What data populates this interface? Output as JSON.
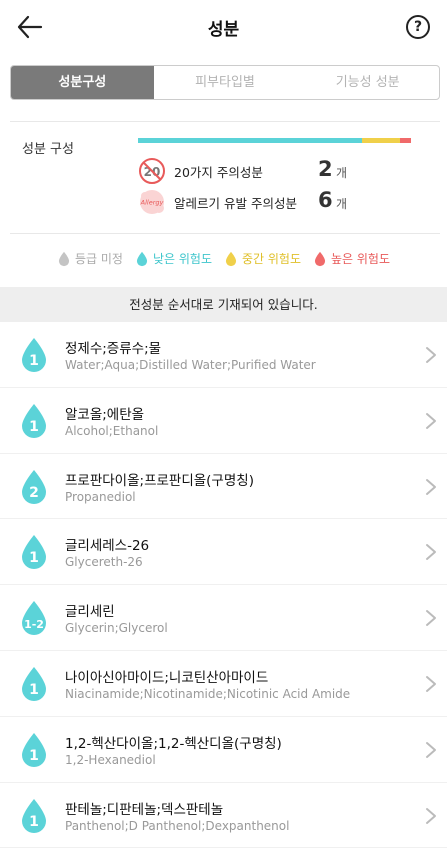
{
  "header": {
    "title": "성분",
    "help_label": "?"
  },
  "tabs": [
    {
      "label": "성분구성",
      "active": true
    },
    {
      "label": "피부타입별",
      "active": false
    },
    {
      "label": "기능성 성분",
      "active": false
    }
  ],
  "composition": {
    "label": "성분 구성",
    "bar_segments": [
      {
        "level": "low",
        "fraction": 0.82,
        "color": "#5bd3d8"
      },
      {
        "level": "medium",
        "fraction": 0.14,
        "color": "#f0d04a"
      },
      {
        "level": "high",
        "fraction": 0.04,
        "color": "#f06a6a"
      }
    ],
    "caution20": {
      "icon_text": "20",
      "label": "20가지 주의성분",
      "count": "2",
      "unit": "개"
    },
    "allergy": {
      "icon_text": "Allergy",
      "label": "알레르기 유발 주의성분",
      "count": "6",
      "unit": "개"
    }
  },
  "legend": [
    {
      "label": "등급 미정",
      "color": "#c4c4c4",
      "text_color": "#aaaaaa"
    },
    {
      "label": "낮은 위험도",
      "color": "#5bd3d8",
      "text_color": "#3fc6cc"
    },
    {
      "label": "중간 위험도",
      "color": "#f0d04a",
      "text_color": "#e0c02a"
    },
    {
      "label": "높은 위험도",
      "color": "#f06a6a",
      "text_color": "#e85a5a"
    }
  ],
  "notice": "전성분 순서대로 기재되어 있습니다.",
  "ingredients": [
    {
      "grade": "1",
      "name": "정제수;증류수;물",
      "english": "Water;Aqua;Distilled Water;Purified Water"
    },
    {
      "grade": "1",
      "name": "알코올;에탄올",
      "english": "Alcohol;Ethanol"
    },
    {
      "grade": "2",
      "name": "프로판다이올;프로판디올(구명칭)",
      "english": "Propanediol"
    },
    {
      "grade": "1",
      "name": "글리세레스-26",
      "english": "Glycereth-26"
    },
    {
      "grade": "1-2",
      "name": "글리세린",
      "english": "Glycerin;Glycerol"
    },
    {
      "grade": "1",
      "name": "나이아신아마이드;니코틴산아마이드",
      "english": "Niacinamide;Nicotinamide;Nicotinic Acid Amide"
    },
    {
      "grade": "1",
      "name": "1,2-헥산다이올;1,2-헥산디올(구명칭)",
      "english": "1,2-Hexanediol"
    },
    {
      "grade": "1",
      "name": "판테놀;디판테놀;덱스판테놀",
      "english": "Panthenol;D Panthenol;Dexpanthenol"
    }
  ],
  "colors": {
    "drop": "#5bd3d8",
    "active_tab": "#7a7a7a",
    "notice_bg": "#eeeeee"
  }
}
